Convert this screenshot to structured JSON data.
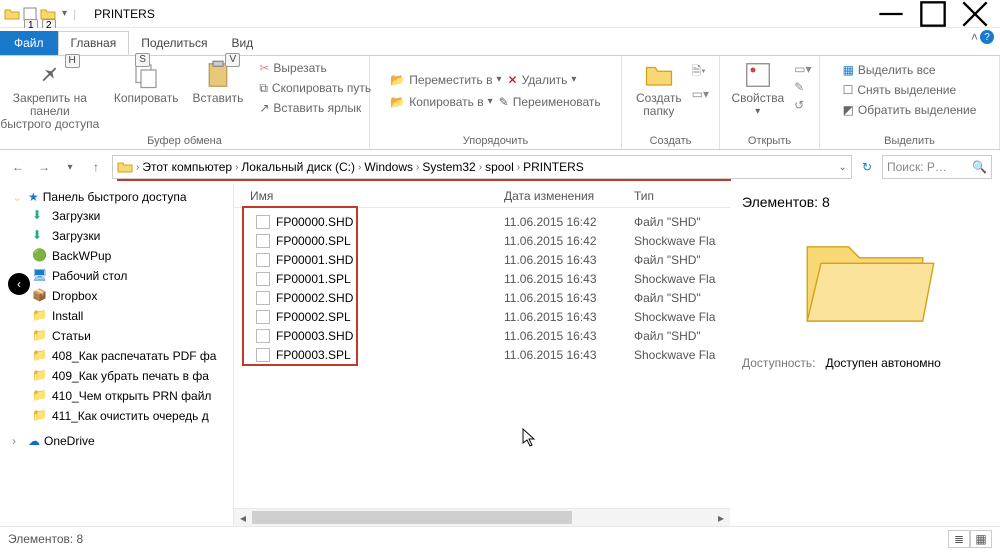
{
  "window": {
    "title": "PRINTERS"
  },
  "tabs": {
    "file": "Файл",
    "home": "Главная",
    "share": "Поделиться",
    "view": "Вид"
  },
  "keytips": {
    "qat1": "1",
    "qat2": "2",
    "home": "H",
    "share": "S",
    "view": "V"
  },
  "ribbon": {
    "clipboard": {
      "label": "Буфер обмена",
      "pin": "Закрепить на панели\nбыстрого доступа",
      "copy": "Копировать",
      "paste": "Вставить",
      "cut": "Вырезать",
      "copypath": "Скопировать путь",
      "pasteshortcut": "Вставить ярлык"
    },
    "organize": {
      "label": "Упорядочить",
      "moveto": "Переместить в",
      "copyto": "Копировать в",
      "delete": "Удалить",
      "rename": "Переименовать"
    },
    "new": {
      "label": "Создать",
      "newfolder": "Создать\nпапку"
    },
    "open": {
      "label": "Открыть",
      "properties": "Свойства"
    },
    "select": {
      "label": "Выделить",
      "selectall": "Выделить все",
      "selectnone": "Снять выделение",
      "invert": "Обратить выделение"
    }
  },
  "breadcrumbs": [
    "Этот компьютер",
    "Локальный диск (C:)",
    "Windows",
    "System32",
    "spool",
    "PRINTERS"
  ],
  "search": {
    "placeholder": "Поиск: P…"
  },
  "columns": {
    "name": "Имя",
    "date": "Дата изменения",
    "type": "Тип"
  },
  "nav": {
    "quick": "Панель быстрого доступа",
    "items": [
      "Загрузки",
      "Загрузки",
      "BackWPup",
      "Рабочий стол",
      "Dropbox",
      "Install",
      "Статьи",
      "408_Как распечатать PDF фа",
      "409_Как убрать печать в фа",
      "410_Чем открыть PRN файл",
      "411_Как очистить очередь д"
    ],
    "onedrive": "OneDrive"
  },
  "files": [
    {
      "name": "FP00000.SHD",
      "date": "11.06.2015 16:42",
      "type": "Файл \"SHD\""
    },
    {
      "name": "FP00000.SPL",
      "date": "11.06.2015 16:42",
      "type": "Shockwave Fla"
    },
    {
      "name": "FP00001.SHD",
      "date": "11.06.2015 16:43",
      "type": "Файл \"SHD\""
    },
    {
      "name": "FP00001.SPL",
      "date": "11.06.2015 16:43",
      "type": "Shockwave Fla"
    },
    {
      "name": "FP00002.SHD",
      "date": "11.06.2015 16:43",
      "type": "Файл \"SHD\""
    },
    {
      "name": "FP00002.SPL",
      "date": "11.06.2015 16:43",
      "type": "Shockwave Fla"
    },
    {
      "name": "FP00003.SHD",
      "date": "11.06.2015 16:43",
      "type": "Файл \"SHD\""
    },
    {
      "name": "FP00003.SPL",
      "date": "11.06.2015 16:43",
      "type": "Shockwave Fla"
    }
  ],
  "details": {
    "heading": "Элементов: 8",
    "avail_label": "Доступность:",
    "avail_value": "Доступен автономно"
  },
  "status": {
    "items": "Элементов: 8"
  }
}
